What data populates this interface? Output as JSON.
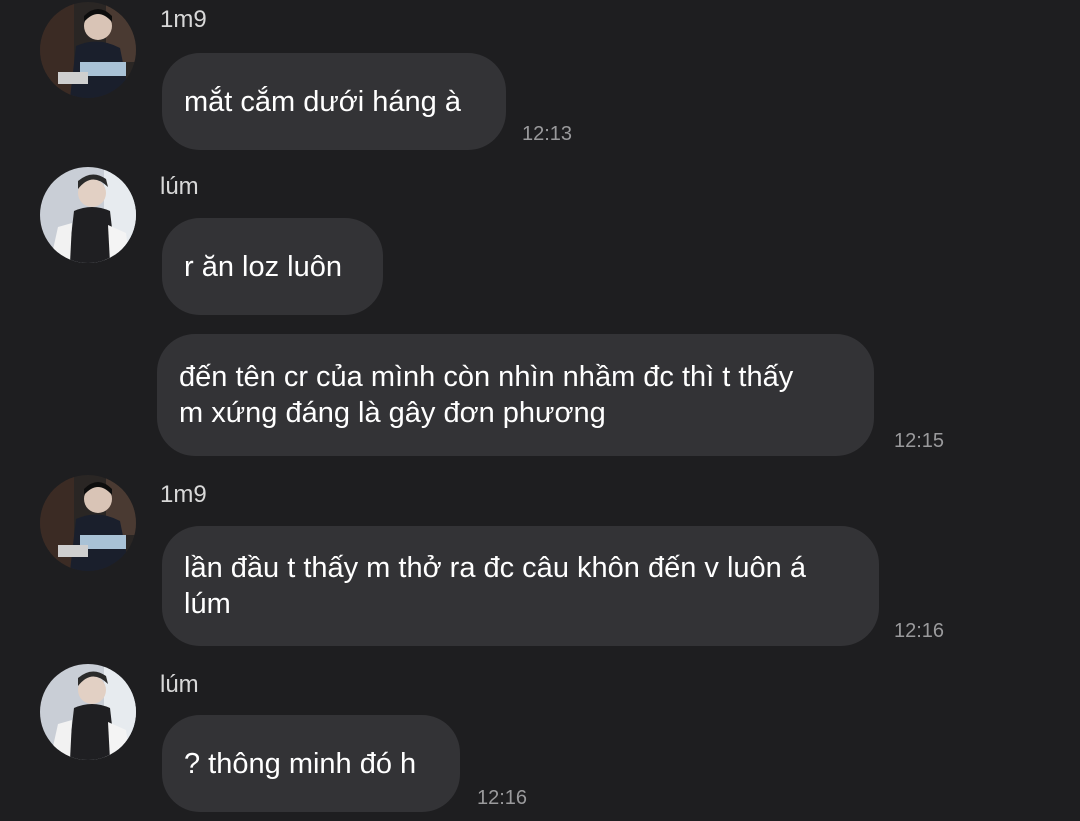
{
  "messages": [
    {
      "sender": "1m9",
      "avatar_icon": "user-avatar-1m9-icon",
      "text": "mắt cắm dưới háng à",
      "time": "12:13"
    },
    {
      "sender": "lúm",
      "avatar_icon": "user-avatar-lum-icon",
      "text": "r ăn loz luôn",
      "time": ""
    },
    {
      "sender": "",
      "text": "đến tên cr của mình còn nhìn nhầm đc thì t thấy\nm xứng đáng là gây đơn phương",
      "time": "12:15"
    },
    {
      "sender": "1m9",
      "avatar_icon": "user-avatar-1m9-icon",
      "text": "lần đầu t thấy m thở ra đc câu khôn đến v luôn á\nlúm",
      "time": "12:16"
    },
    {
      "sender": "lúm",
      "avatar_icon": "user-avatar-lum-icon",
      "text": "? thông minh đó h",
      "time": "12:16"
    }
  ],
  "colors": {
    "background": "#1e1e20",
    "bubble": "#333336",
    "text": "#ffffff",
    "sender": "#d8d8d8",
    "timestamp": "#9a9a9c"
  }
}
